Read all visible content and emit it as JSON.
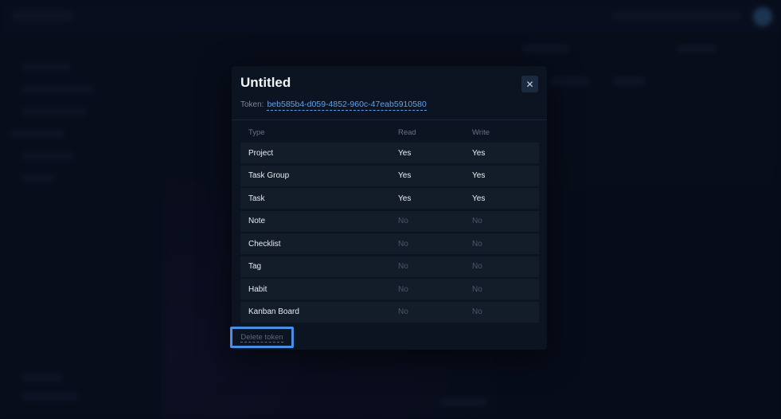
{
  "modal": {
    "title": "Untitled",
    "close_icon": "close-icon",
    "token_label": "Token:",
    "token_value": "beb585b4-d059-4852-960c-47eab5910580"
  },
  "table": {
    "headers": {
      "type": "Type",
      "read": "Read",
      "write": "Write"
    },
    "rows": [
      {
        "type": "Project",
        "read": "Yes",
        "write": "Yes"
      },
      {
        "type": "Task Group",
        "read": "Yes",
        "write": "Yes"
      },
      {
        "type": "Task",
        "read": "Yes",
        "write": "Yes"
      },
      {
        "type": "Note",
        "read": "No",
        "write": "No"
      },
      {
        "type": "Checklist",
        "read": "No",
        "write": "No"
      },
      {
        "type": "Tag",
        "read": "No",
        "write": "No"
      },
      {
        "type": "Habit",
        "read": "No",
        "write": "No"
      },
      {
        "type": "Kanban Board",
        "read": "No",
        "write": "No"
      }
    ]
  },
  "actions": {
    "delete_label": "Delete token"
  },
  "colors": {
    "accent": "#4a90e2",
    "link": "#5fa1ee",
    "modal_bg": "#0c1422",
    "row_bg": "#131d2a"
  }
}
